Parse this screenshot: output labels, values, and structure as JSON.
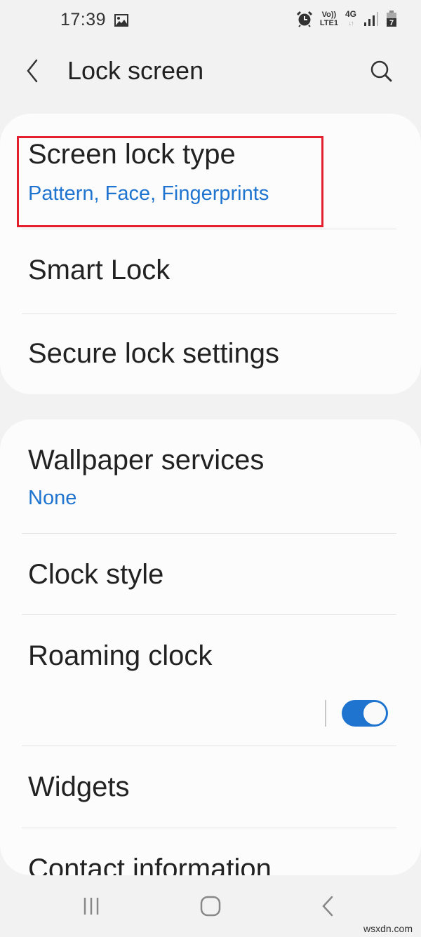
{
  "status_bar": {
    "time": "17:39",
    "left_icons": [
      "gallery-notification-icon"
    ],
    "volte_line1": "Vo))",
    "volte_line2": "LTE1",
    "network_type": "4G",
    "network_arrows": "↓↑",
    "right_icons": [
      "alarm-icon",
      "volte-icon",
      "4g-data-icon",
      "signal-icon",
      "battery-charging-icon"
    ],
    "battery_level": "7"
  },
  "app_bar": {
    "title": "Lock screen",
    "back_icon": "chevron-left-icon",
    "search_icon": "search-icon"
  },
  "sections": [
    {
      "items": [
        {
          "title": "Screen lock type",
          "subtitle": "Pattern, Face, Fingerprints",
          "highlighted": true
        },
        {
          "title": "Smart Lock"
        },
        {
          "title": "Secure lock settings"
        }
      ]
    },
    {
      "items": [
        {
          "title": "Wallpaper services",
          "subtitle": "None"
        },
        {
          "title": "Clock style"
        },
        {
          "title": "Roaming clock",
          "toggle": true
        },
        {
          "title": "Widgets"
        },
        {
          "title": "Contact information"
        }
      ]
    }
  ],
  "colors": {
    "accent": "#1f74d0",
    "highlight_border": "#e2202e",
    "background": "#f2f2f2",
    "card": "#fcfcfc"
  },
  "nav_bar": {
    "recents_icon": "recents-icon",
    "home_icon": "home-icon",
    "back_icon": "back-icon"
  },
  "watermark": "wsxdn.com"
}
